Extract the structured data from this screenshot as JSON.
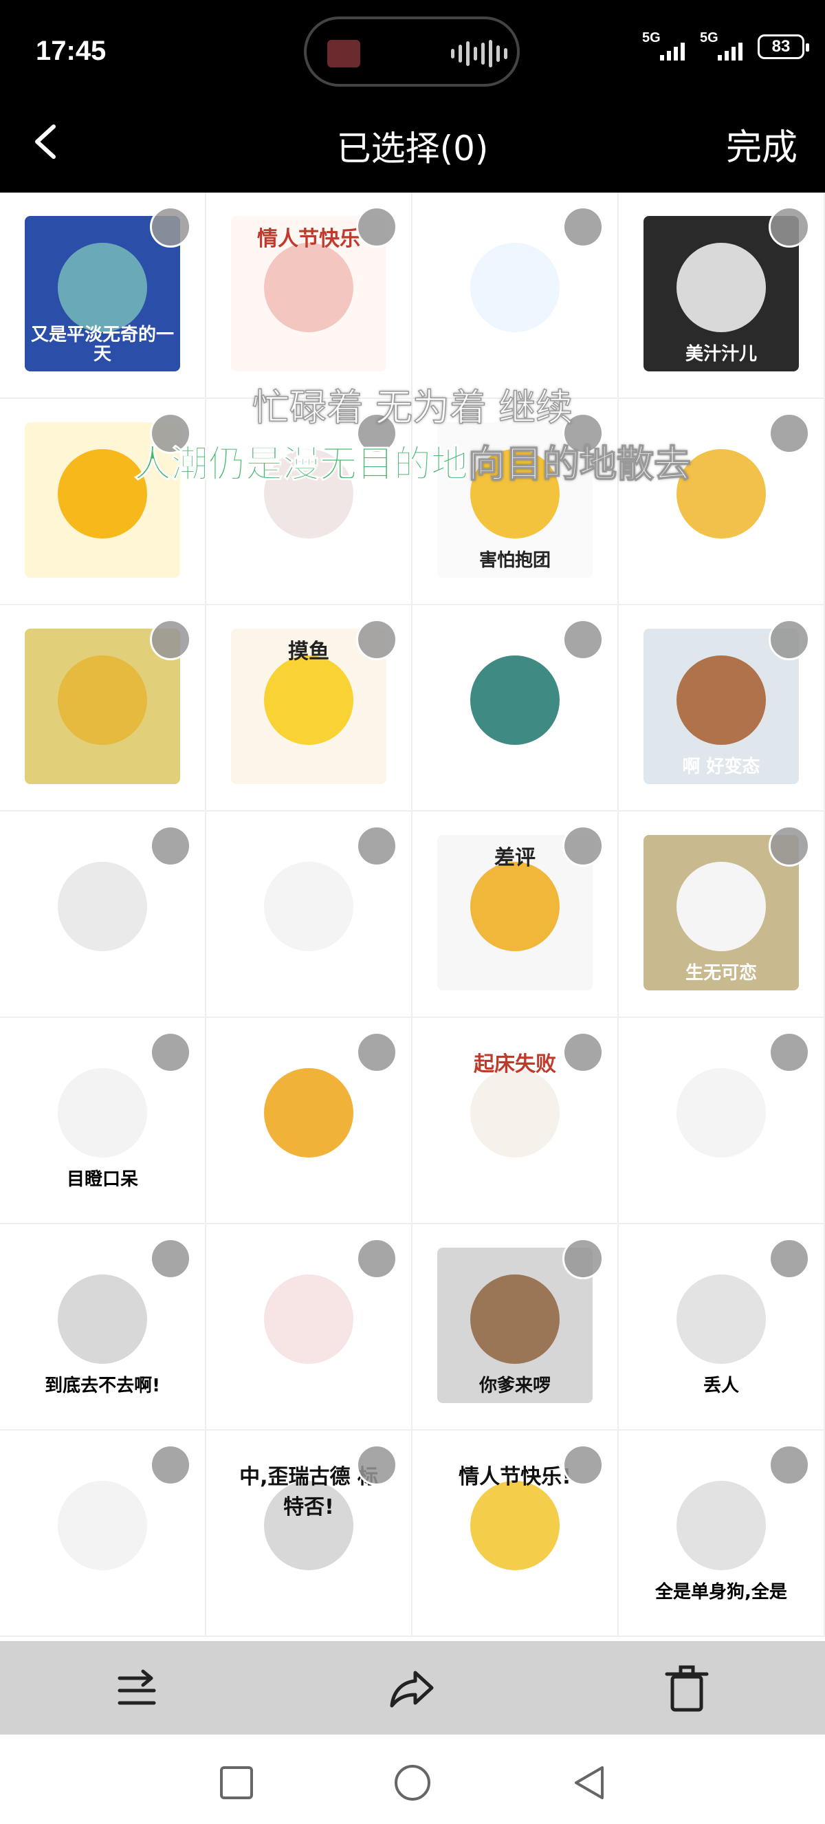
{
  "status_bar": {
    "time": "17:45",
    "network1": "5G",
    "network2": "5G",
    "battery": "83"
  },
  "nav": {
    "title": "已选择(0)",
    "done_label": "完成"
  },
  "lyrics": {
    "line1": "忙碌着 无为着 继续",
    "line2_highlight": "人潮仍是漫无目的地",
    "line2_rest": "向目的地散去"
  },
  "stickers": [
    {
      "caption": "又是平淡无奇的一天",
      "top": "",
      "bg": "#2b4fa8",
      "face": "#6aa9b8",
      "color": "#fff"
    },
    {
      "caption": "",
      "top": "情人节快乐",
      "bg": "#fff7f3",
      "face": "#f3c6c0",
      "color": "#c0392b"
    },
    {
      "caption": "",
      "top": "",
      "bg": "#ffffff",
      "face": "#eef6ff",
      "color": "#000"
    },
    {
      "caption": "美汁汁儿",
      "top": "",
      "bg": "#2a2a2a",
      "face": "#d9d9d9",
      "color": "#fff"
    },
    {
      "caption": "",
      "top": "",
      "bg": "#fff6d6",
      "face": "#f7b81c",
      "color": "#000"
    },
    {
      "caption": "",
      "top": "",
      "bg": "#ffffff",
      "face": "#f1e6e6",
      "color": "#000"
    },
    {
      "caption": "害怕抱团",
      "top": "",
      "bg": "#fafafa",
      "face": "#f3c33d",
      "color": "#222"
    },
    {
      "caption": "",
      "top": "",
      "bg": "#ffffff",
      "face": "#f2c149",
      "color": "#000"
    },
    {
      "caption": "",
      "top": "",
      "bg": "#e2cf7a",
      "face": "#e6b93f",
      "color": "#000"
    },
    {
      "caption": "",
      "top": "摸鱼",
      "bg": "#fbf5ea",
      "face": "#f9d233",
      "color": "#222"
    },
    {
      "caption": "",
      "top": "",
      "bg": "#ffffff",
      "face": "#3f8b84",
      "color": "#000"
    },
    {
      "caption": "啊 好变态",
      "top": "",
      "bg": "#dfe7ec",
      "face": "#b0724a",
      "color": "#fff"
    },
    {
      "caption": "",
      "top": "",
      "bg": "#ffffff",
      "face": "#eaeaea",
      "color": "#000"
    },
    {
      "caption": "",
      "top": "",
      "bg": "#ffffff",
      "face": "#f4f4f4",
      "color": "#000"
    },
    {
      "caption": "",
      "top": "差评",
      "bg": "#f7f7f7",
      "face": "#f0b73a",
      "color": "#222"
    },
    {
      "caption": "生无可恋",
      "top": "",
      "bg": "#c9b98e",
      "face": "#f5f5f5",
      "color": "#fff"
    },
    {
      "caption": "目瞪口呆",
      "top": "",
      "bg": "#ffffff",
      "face": "#f3f3f3",
      "color": "#000"
    },
    {
      "caption": "",
      "top": "",
      "bg": "#ffffff",
      "face": "#f1b23a",
      "color": "#000"
    },
    {
      "caption": "",
      "top": "起床失败",
      "bg": "#ffffff",
      "face": "#f7f1ec",
      "color": "#c0392b"
    },
    {
      "caption": "",
      "top": "",
      "bg": "#ffffff",
      "face": "#f4f4f4",
      "color": "#000"
    },
    {
      "caption": "到底去不去啊!",
      "top": "",
      "bg": "#ffffff",
      "face": "#d8d8d8",
      "color": "#000"
    },
    {
      "caption": "",
      "top": "",
      "bg": "#ffffff",
      "face": "#f7e4e4",
      "color": "#000"
    },
    {
      "caption": "你爹来啰",
      "top": "",
      "bg": "#d6d6d6",
      "face": "#9a7656",
      "color": "#111"
    },
    {
      "caption": "丢人",
      "top": "",
      "bg": "#ffffff",
      "face": "#e3e3e3",
      "color": "#000"
    },
    {
      "caption": "",
      "top": "",
      "bg": "#ffffff",
      "face": "#f3f3f3",
      "color": "#000"
    },
    {
      "caption": "",
      "top": "中,歪瑞古德 标特否!",
      "bg": "#ffffff",
      "face": "#d8d8d8",
      "color": "#111"
    },
    {
      "caption": "",
      "top": "情人节快乐!",
      "bg": "#ffffff",
      "face": "#f4ce4a",
      "color": "#111"
    },
    {
      "caption": "全是单身狗,全是",
      "top": "",
      "bg": "#ffffff",
      "face": "#e2e2e2",
      "color": "#000"
    }
  ],
  "icons": {
    "back": "chevron-left-icon",
    "sort": "sort-icon",
    "share": "share-icon",
    "delete": "trash-icon"
  },
  "colors": {
    "nav_bg": "#000000",
    "toolbar_bg": "#d2d2d2",
    "lyric_highlight": "#43b86b"
  }
}
